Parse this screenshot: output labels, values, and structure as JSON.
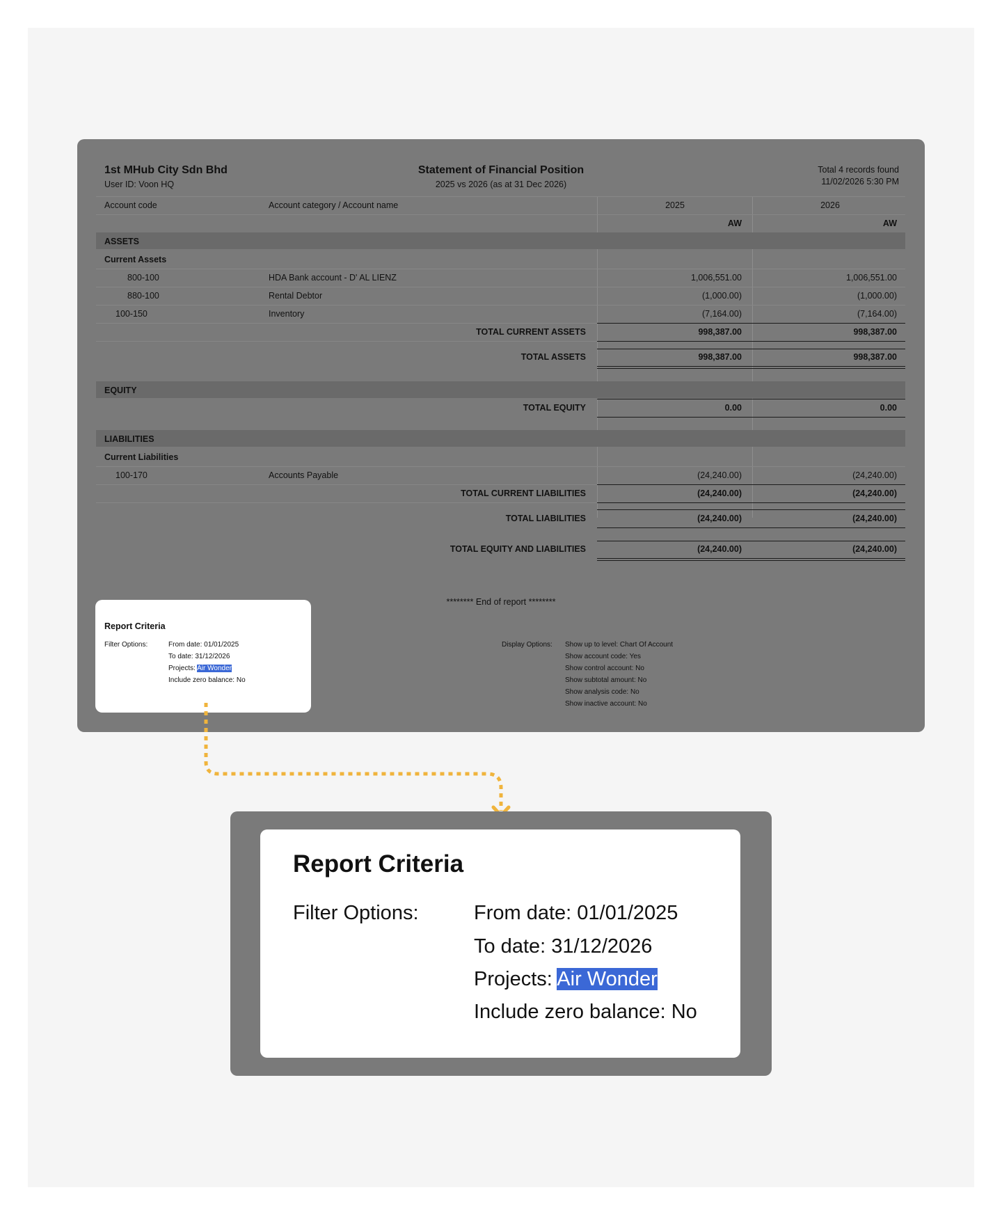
{
  "header": {
    "company": "1st MHub City Sdn Bhd",
    "user": "User ID: Voon HQ",
    "title": "Statement of Financial Position",
    "subtitle": "2025 vs 2026 (as at 31 Dec 2026)",
    "records": "Total 4 records found",
    "datetime": "11/02/2026 5:30 PM"
  },
  "columns": {
    "code": "Account code",
    "name": "Account category / Account name",
    "y1": "2025",
    "y2": "2026",
    "sub1": "AW",
    "sub2": "AW"
  },
  "assets": {
    "heading": "ASSETS",
    "subheading": "Current Assets",
    "rows": [
      {
        "code": "800-100",
        "name": "HDA Bank account - D' AL LIENZ",
        "v1": "1,006,551.00",
        "v2": "1,006,551.00"
      },
      {
        "code": "880-100",
        "name": "Rental Debtor",
        "v1": "(1,000.00)",
        "v2": "(1,000.00)"
      },
      {
        "code": "100-150",
        "name": "Inventory",
        "v1": "(7,164.00)",
        "v2": "(7,164.00)"
      }
    ],
    "total_current_label": "TOTAL CURRENT ASSETS",
    "total_current_v1": "998,387.00",
    "total_current_v2": "998,387.00",
    "total_label": "TOTAL ASSETS",
    "total_v1": "998,387.00",
    "total_v2": "998,387.00"
  },
  "equity": {
    "heading": "EQUITY",
    "total_label": "TOTAL EQUITY",
    "total_v1": "0.00",
    "total_v2": "0.00"
  },
  "liabilities": {
    "heading": "LIABILITIES",
    "subheading": "Current Liabilities",
    "rows": [
      {
        "code": "100-170",
        "name": "Accounts Payable",
        "v1": "(24,240.00)",
        "v2": "(24,240.00)"
      }
    ],
    "total_current_label": "TOTAL CURRENT LIABILITIES",
    "total_current_v1": "(24,240.00)",
    "total_current_v2": "(24,240.00)",
    "total_label": "TOTAL LIABILITIES",
    "total_v1": "(24,240.00)",
    "total_v2": "(24,240.00)"
  },
  "grand_total": {
    "label": "TOTAL EQUITY AND LIABILITIES",
    "v1": "(24,240.00)",
    "v2": "(24,240.00)"
  },
  "end_of_report": "********  End of report  ********",
  "criteria": {
    "title": "Report Criteria",
    "filter_label": "Filter Options:",
    "from_date": "From date: 01/01/2025",
    "to_date": "To date: 31/12/2026",
    "projects_label": "Projects: ",
    "projects_value": "Air Wonder",
    "zero_balance": "Include zero balance: No"
  },
  "display_options": {
    "label": "Display Options:",
    "items": [
      "Show up to level: Chart Of Account",
      "Show account code: Yes",
      "Show control account: No",
      "Show subtotal amount: No",
      "Show analysis code: No",
      "Show inactive account: No"
    ]
  },
  "colors": {
    "report_overlay": "#7a7a7a",
    "highlight": "#3b68d6",
    "connector": "#f0b43c"
  }
}
